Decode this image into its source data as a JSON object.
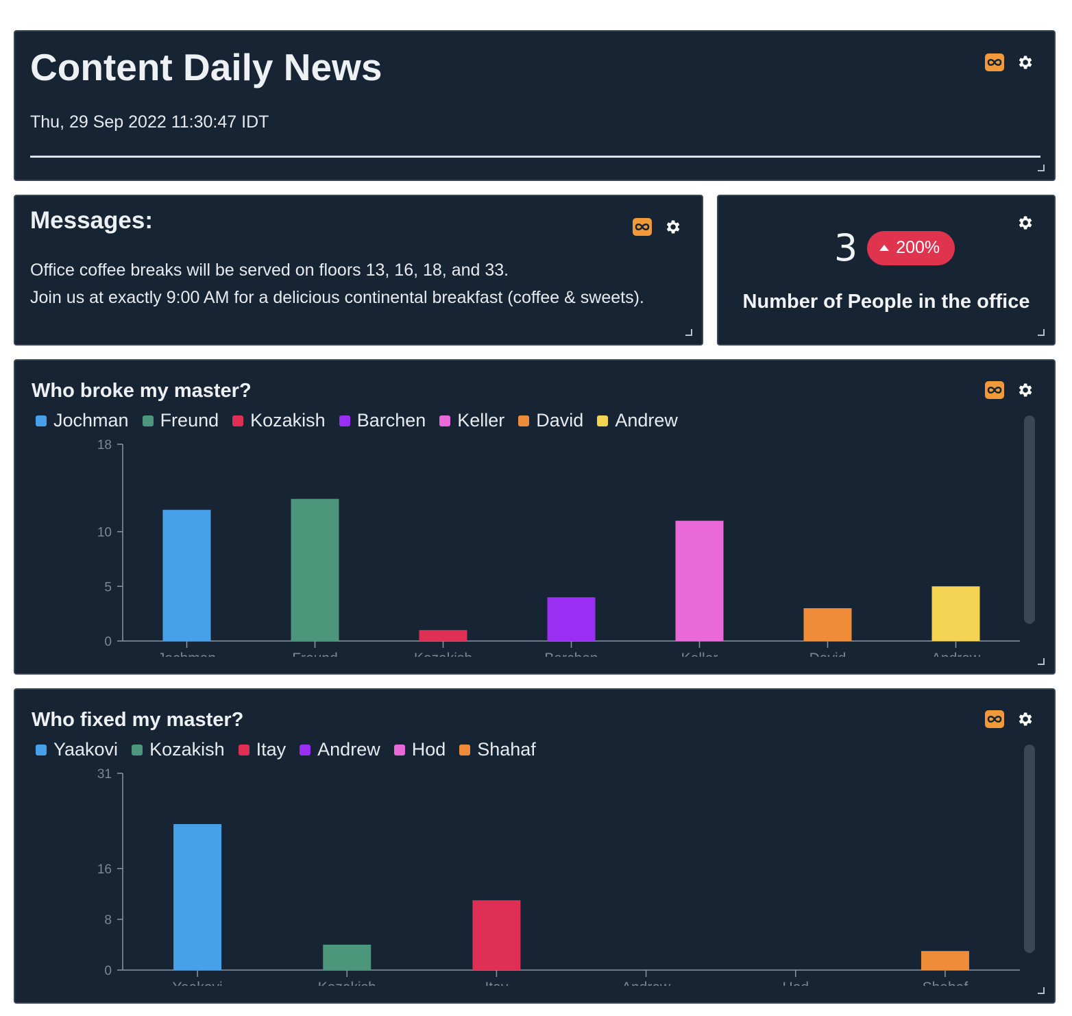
{
  "header": {
    "title": "Content Daily News",
    "date": "Thu, 29 Sep 2022 11:30:47 IDT"
  },
  "messages": {
    "title": "Messages:",
    "lines": [
      "Office coffee breaks will be served on floors 13, 16, 18, and 33.",
      "Join us at exactly 9:00 AM for a delicious continental breakfast (coffee & sweets)."
    ]
  },
  "kpi": {
    "value": "3",
    "change": "200%",
    "label": "Number of People in the office"
  },
  "colors": {
    "panel_bg": "#172434",
    "accent_orange": "#f09a3a",
    "badge_red": "#e0334d",
    "series": [
      "#47a0e8",
      "#4c977c",
      "#e02f55",
      "#9b2ef3",
      "#e969d8",
      "#ef8c3a",
      "#f5d352"
    ]
  },
  "icons": {
    "infinity": "infinity-icon",
    "settings": "gear-icon",
    "resize": "resize-handle-icon",
    "trend": "triangle-up-icon"
  },
  "chart_data": [
    {
      "type": "bar",
      "title": "Who broke my master?",
      "categories": [
        "Jochman",
        "Freund",
        "Kozakish",
        "Barchen",
        "Keller",
        "David",
        "Andrew"
      ],
      "values": [
        12,
        13,
        1,
        4,
        11,
        3,
        5
      ],
      "yticks": [
        0,
        5,
        10,
        18
      ],
      "ylim": [
        0,
        18
      ],
      "legend": "top-left",
      "grid": false
    },
    {
      "type": "bar",
      "title": "Who fixed my master?",
      "categories": [
        "Yaakovi",
        "Kozakish",
        "Itay",
        "Andrew",
        "Hod",
        "Shahaf"
      ],
      "values": [
        23,
        4,
        11,
        0,
        0,
        3
      ],
      "yticks": [
        0,
        8,
        16,
        31
      ],
      "ylim": [
        0,
        31
      ],
      "legend": "top-left",
      "grid": false
    }
  ]
}
